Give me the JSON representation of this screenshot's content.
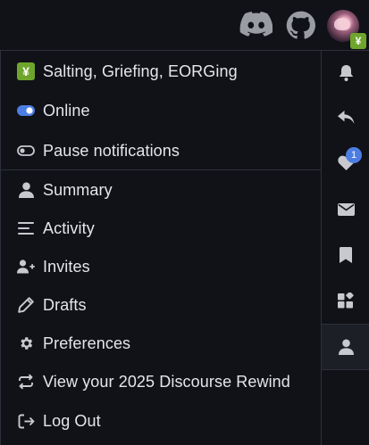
{
  "header": {
    "icons": [
      "discord-icon",
      "github-icon"
    ],
    "avatar_status_glyph": "¥"
  },
  "menu": {
    "status": {
      "emoji": "¥",
      "label": "Salting, Griefing, EORGing"
    },
    "presence": {
      "label": "Online"
    },
    "pause": {
      "label": "Pause notifications"
    },
    "items": [
      {
        "label": "Summary",
        "icon": "user-icon"
      },
      {
        "label": "Activity",
        "icon": "activity-lines-icon"
      },
      {
        "label": "Invites",
        "icon": "user-plus-icon"
      },
      {
        "label": "Drafts",
        "icon": "pencil-icon"
      },
      {
        "label": "Preferences",
        "icon": "gear-icon"
      },
      {
        "label": "View your 2025 Discourse Rewind",
        "icon": "repeat-icon"
      },
      {
        "label": "Log Out",
        "icon": "sign-out-icon"
      }
    ]
  },
  "rail": {
    "likes_badge": "1",
    "buttons": [
      "bell-icon",
      "reply-icon",
      "heart-icon",
      "envelope-icon",
      "bookmark-icon",
      "widgets-icon",
      "user-icon"
    ]
  },
  "colors": {
    "background": "#111217",
    "text": "#e4e6ec",
    "icon": "#c7c9cf",
    "toggle": "#4c7de3",
    "status_green": "#6ea52c"
  }
}
